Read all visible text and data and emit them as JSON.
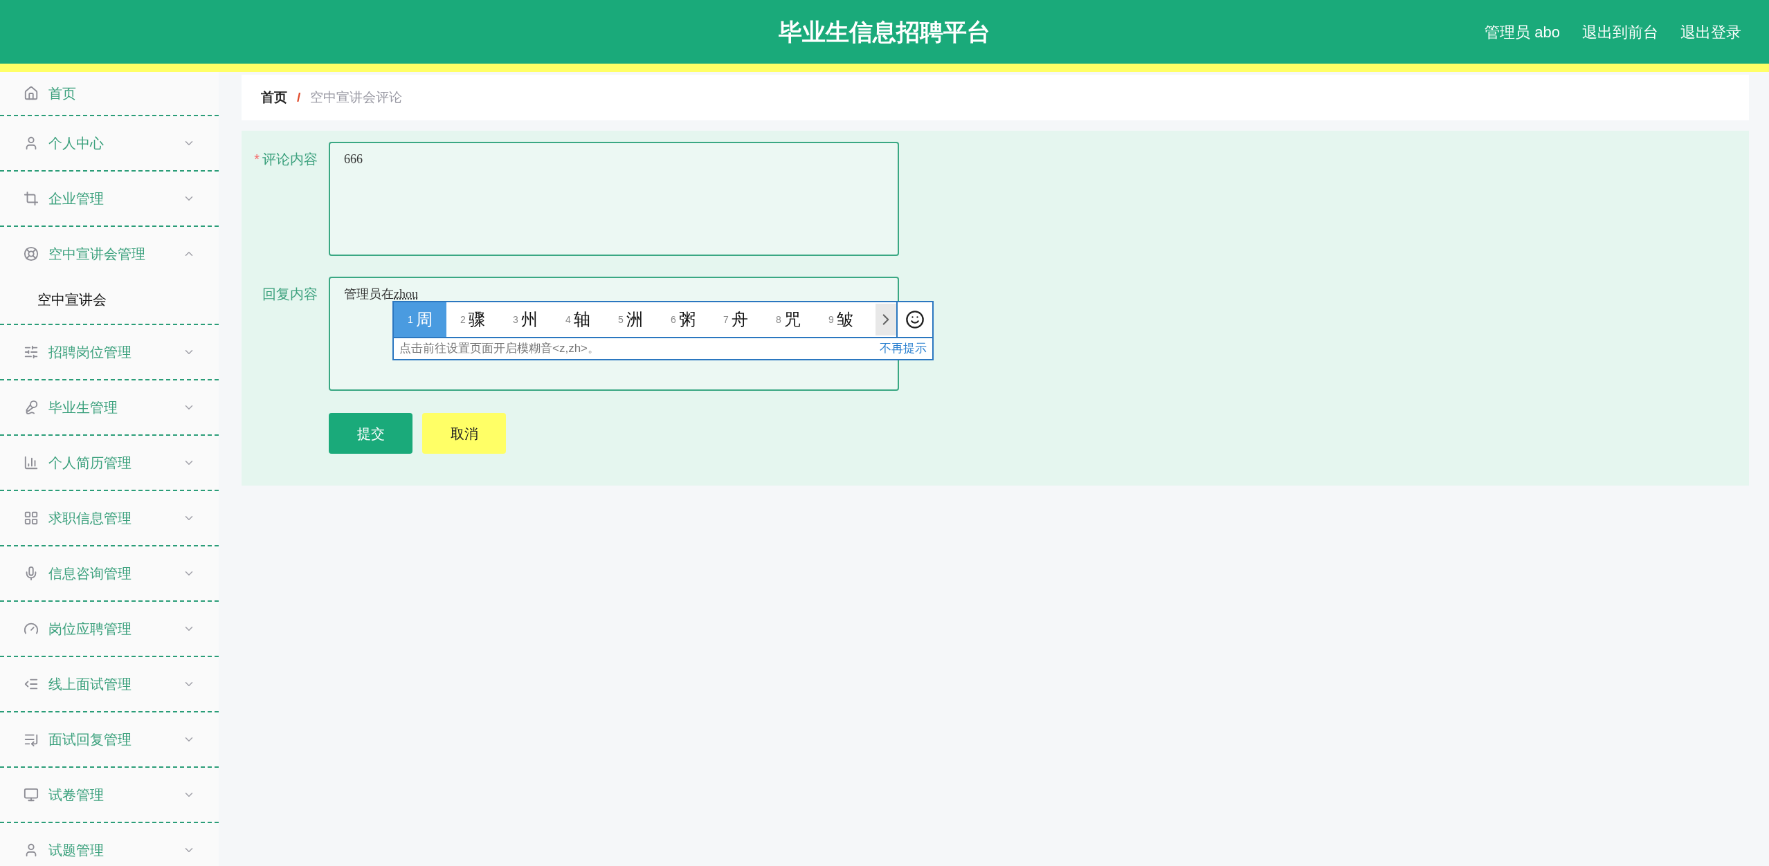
{
  "header": {
    "title": "毕业生信息招聘平台",
    "user": "管理员 abo",
    "links": [
      "退出到前台",
      "退出登录"
    ]
  },
  "sidebar": {
    "items": [
      {
        "label": "首页",
        "kind": "link"
      },
      {
        "label": "个人中心",
        "kind": "group",
        "expanded": false
      },
      {
        "label": "企业管理",
        "kind": "group",
        "expanded": false
      },
      {
        "label": "空中宣讲会管理",
        "kind": "group",
        "expanded": true,
        "children": [
          {
            "label": "空中宣讲会"
          }
        ]
      },
      {
        "label": "招聘岗位管理",
        "kind": "group",
        "expanded": false
      },
      {
        "label": "毕业生管理",
        "kind": "group",
        "expanded": false
      },
      {
        "label": "个人简历管理",
        "kind": "group",
        "expanded": false
      },
      {
        "label": "求职信息管理",
        "kind": "group",
        "expanded": false
      },
      {
        "label": "信息咨询管理",
        "kind": "group",
        "expanded": false
      },
      {
        "label": "岗位应聘管理",
        "kind": "group",
        "expanded": false
      },
      {
        "label": "线上面试管理",
        "kind": "group",
        "expanded": false
      },
      {
        "label": "面试回复管理",
        "kind": "group",
        "expanded": false
      },
      {
        "label": "试卷管理",
        "kind": "group",
        "expanded": false
      },
      {
        "label": "试题管理",
        "kind": "group",
        "expanded": false
      }
    ]
  },
  "breadcrumb": {
    "items": [
      "首页",
      "空中宣讲会评论"
    ],
    "separator": "/"
  },
  "form": {
    "fields": [
      {
        "label": "评论内容",
        "required_mark": "*",
        "value": "666"
      },
      {
        "label": "回复内容",
        "value": "管理员在",
        "composition": "zhou"
      }
    ],
    "buttons": [
      {
        "label": "提交",
        "kind": "primary"
      },
      {
        "label": "取消",
        "kind": "secondary"
      }
    ]
  },
  "ime": {
    "candidates": [
      {
        "index": "1",
        "char": "周",
        "selected": true
      },
      {
        "index": "2",
        "char": "骤",
        "selected": false
      },
      {
        "index": "3",
        "char": "州",
        "selected": false
      },
      {
        "index": "4",
        "char": "轴",
        "selected": false
      },
      {
        "index": "5",
        "char": "洲",
        "selected": false
      },
      {
        "index": "6",
        "char": "粥",
        "selected": false
      },
      {
        "index": "7",
        "char": "舟",
        "selected": false
      },
      {
        "index": "8",
        "char": "咒",
        "selected": false
      },
      {
        "index": "9",
        "char": "皱",
        "selected": false
      }
    ],
    "hint": "点击前往设置页面开启模糊音<z,zh>。",
    "dismiss": "不再提示"
  }
}
